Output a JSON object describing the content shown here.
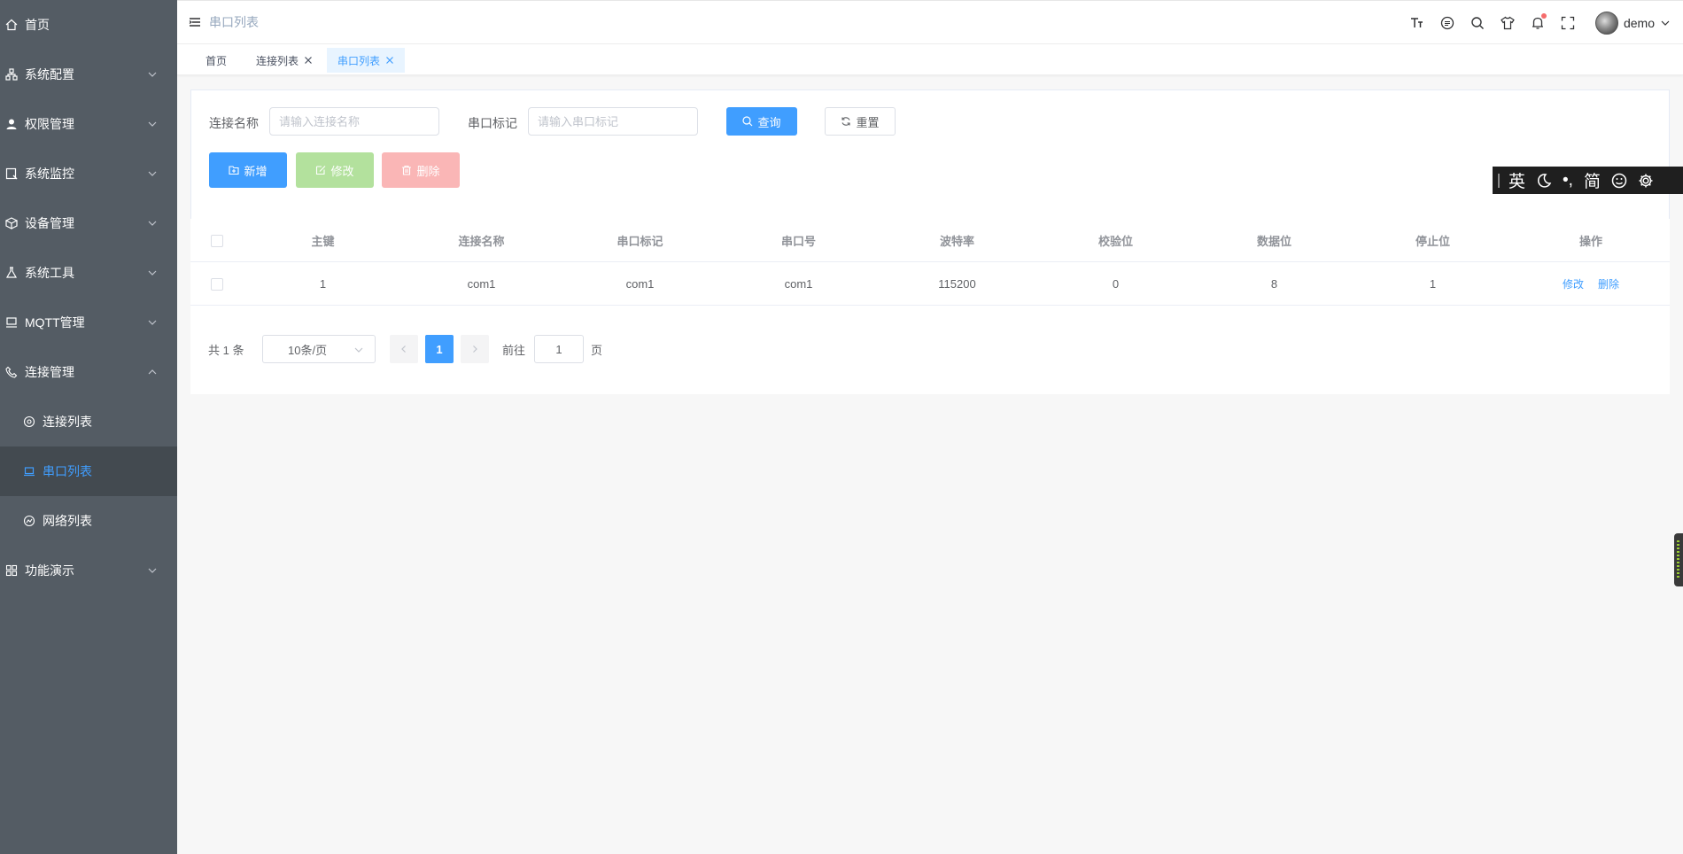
{
  "sidebar": {
    "items": [
      {
        "label": "首页",
        "icon": "home-icon"
      },
      {
        "label": "系统配置",
        "icon": "cluster-icon"
      },
      {
        "label": "权限管理",
        "icon": "user-icon"
      },
      {
        "label": "系统监控",
        "icon": "monitor-icon"
      },
      {
        "label": "设备管理",
        "icon": "cube-icon"
      },
      {
        "label": "系统工具",
        "icon": "tool-icon"
      },
      {
        "label": "MQTT管理",
        "icon": "server-icon"
      },
      {
        "label": "连接管理",
        "icon": "phone-icon"
      }
    ],
    "subitems": [
      {
        "label": "连接列表",
        "icon": "connection-icon"
      },
      {
        "label": "串口列表",
        "icon": "laptop-icon"
      },
      {
        "label": "网络列表",
        "icon": "network-icon"
      }
    ],
    "last": {
      "label": "功能演示",
      "icon": "grid-icon"
    },
    "accent": "#409eff"
  },
  "header": {
    "breadcrumb": "串口列表",
    "username": "demo"
  },
  "tags": [
    {
      "label": "首页"
    },
    {
      "label": "连接列表"
    },
    {
      "label": "串口列表"
    }
  ],
  "search": {
    "name_label": "连接名称",
    "name_placeholder": "请输入连接名称",
    "mark_label": "串口标记",
    "mark_placeholder": "请输入串口标记",
    "query": "查询",
    "reset": "重置",
    "add": "新增",
    "edit": "修改",
    "delete": "删除"
  },
  "ime": {
    "lang": "英",
    "punct": "•,",
    "charset": "简"
  },
  "table": {
    "headers": [
      "主键",
      "连接名称",
      "串口标记",
      "串口号",
      "波特率",
      "校验位",
      "数据位",
      "停止位",
      "操作"
    ],
    "rows": [
      {
        "id": "1",
        "name": "com1",
        "mark": "com1",
        "port": "com1",
        "baud": "115200",
        "parity": "0",
        "databits": "8",
        "stopbits": "1",
        "edit": "修改",
        "delete": "删除"
      }
    ]
  },
  "pagination": {
    "total": "共 1 条",
    "page_size": "10条/页",
    "current": "1",
    "goto_label": "前往",
    "goto_value": "1",
    "unit": "页"
  }
}
